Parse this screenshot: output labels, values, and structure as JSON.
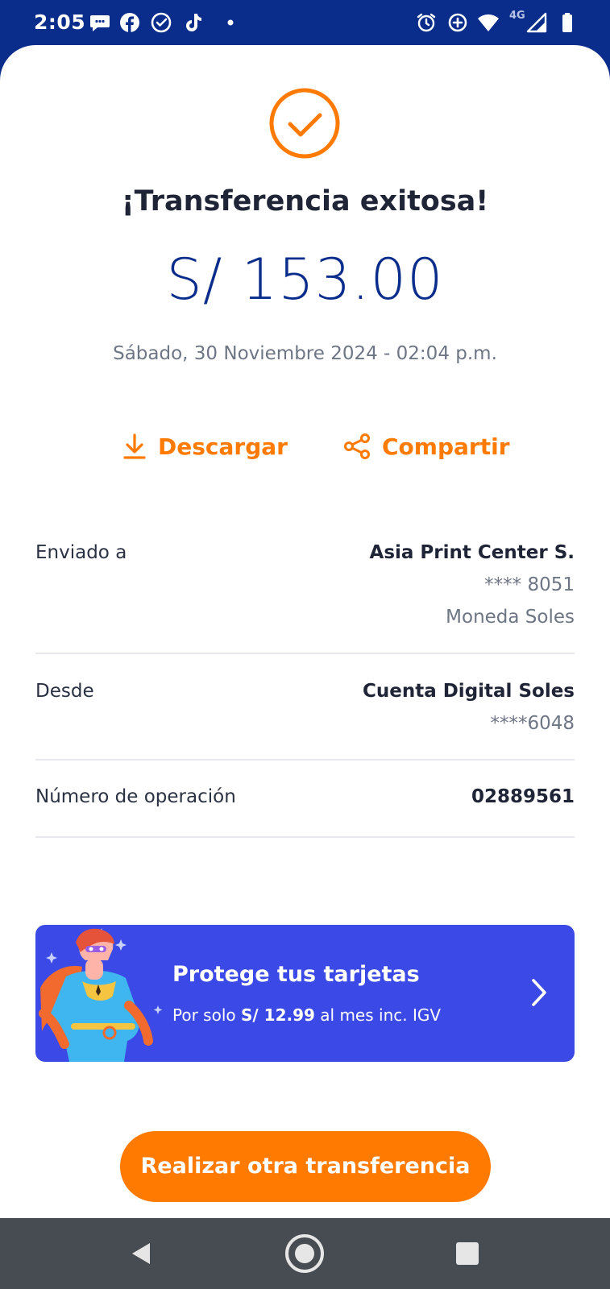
{
  "status_bar": {
    "time": "2:05",
    "left_icons": [
      "messages-icon",
      "facebook-icon",
      "check-circle-icon",
      "tiktok-icon",
      "dot-icon"
    ],
    "right_icons": [
      "alarm-icon",
      "data-saver-icon",
      "wifi-icon",
      "signal-icon",
      "battery-icon"
    ],
    "network_label": "4G"
  },
  "receipt": {
    "status_icon": "check-circle-icon",
    "title": "¡Transferencia exitosa!",
    "amount": "S/ 153.00",
    "datetime": "Sábado, 30 Noviembre 2024 - 02:04 p.m.",
    "actions": {
      "download_label": "Descargar",
      "share_label": "Compartir"
    },
    "details": {
      "sent_to": {
        "label": "Enviado a",
        "name": "Asia Print Center S.",
        "account": "**** 8051",
        "currency": "Moneda Soles"
      },
      "from": {
        "label": "Desde",
        "name": "Cuenta Digital Soles",
        "account": "****6048"
      },
      "operation": {
        "label": "Número de operación",
        "number": "02889561"
      }
    }
  },
  "promo": {
    "title": "Protege tus tarjetas",
    "sub_prefix": "Por solo",
    "price": "S/ 12.99",
    "sub_suffix": "al mes inc. IGV"
  },
  "cta": {
    "label": "Realizar otra transferencia"
  },
  "colors": {
    "brand_blue": "#0a2d8c",
    "accent_orange": "#ff7a00",
    "promo_blue": "#3b49e6"
  }
}
